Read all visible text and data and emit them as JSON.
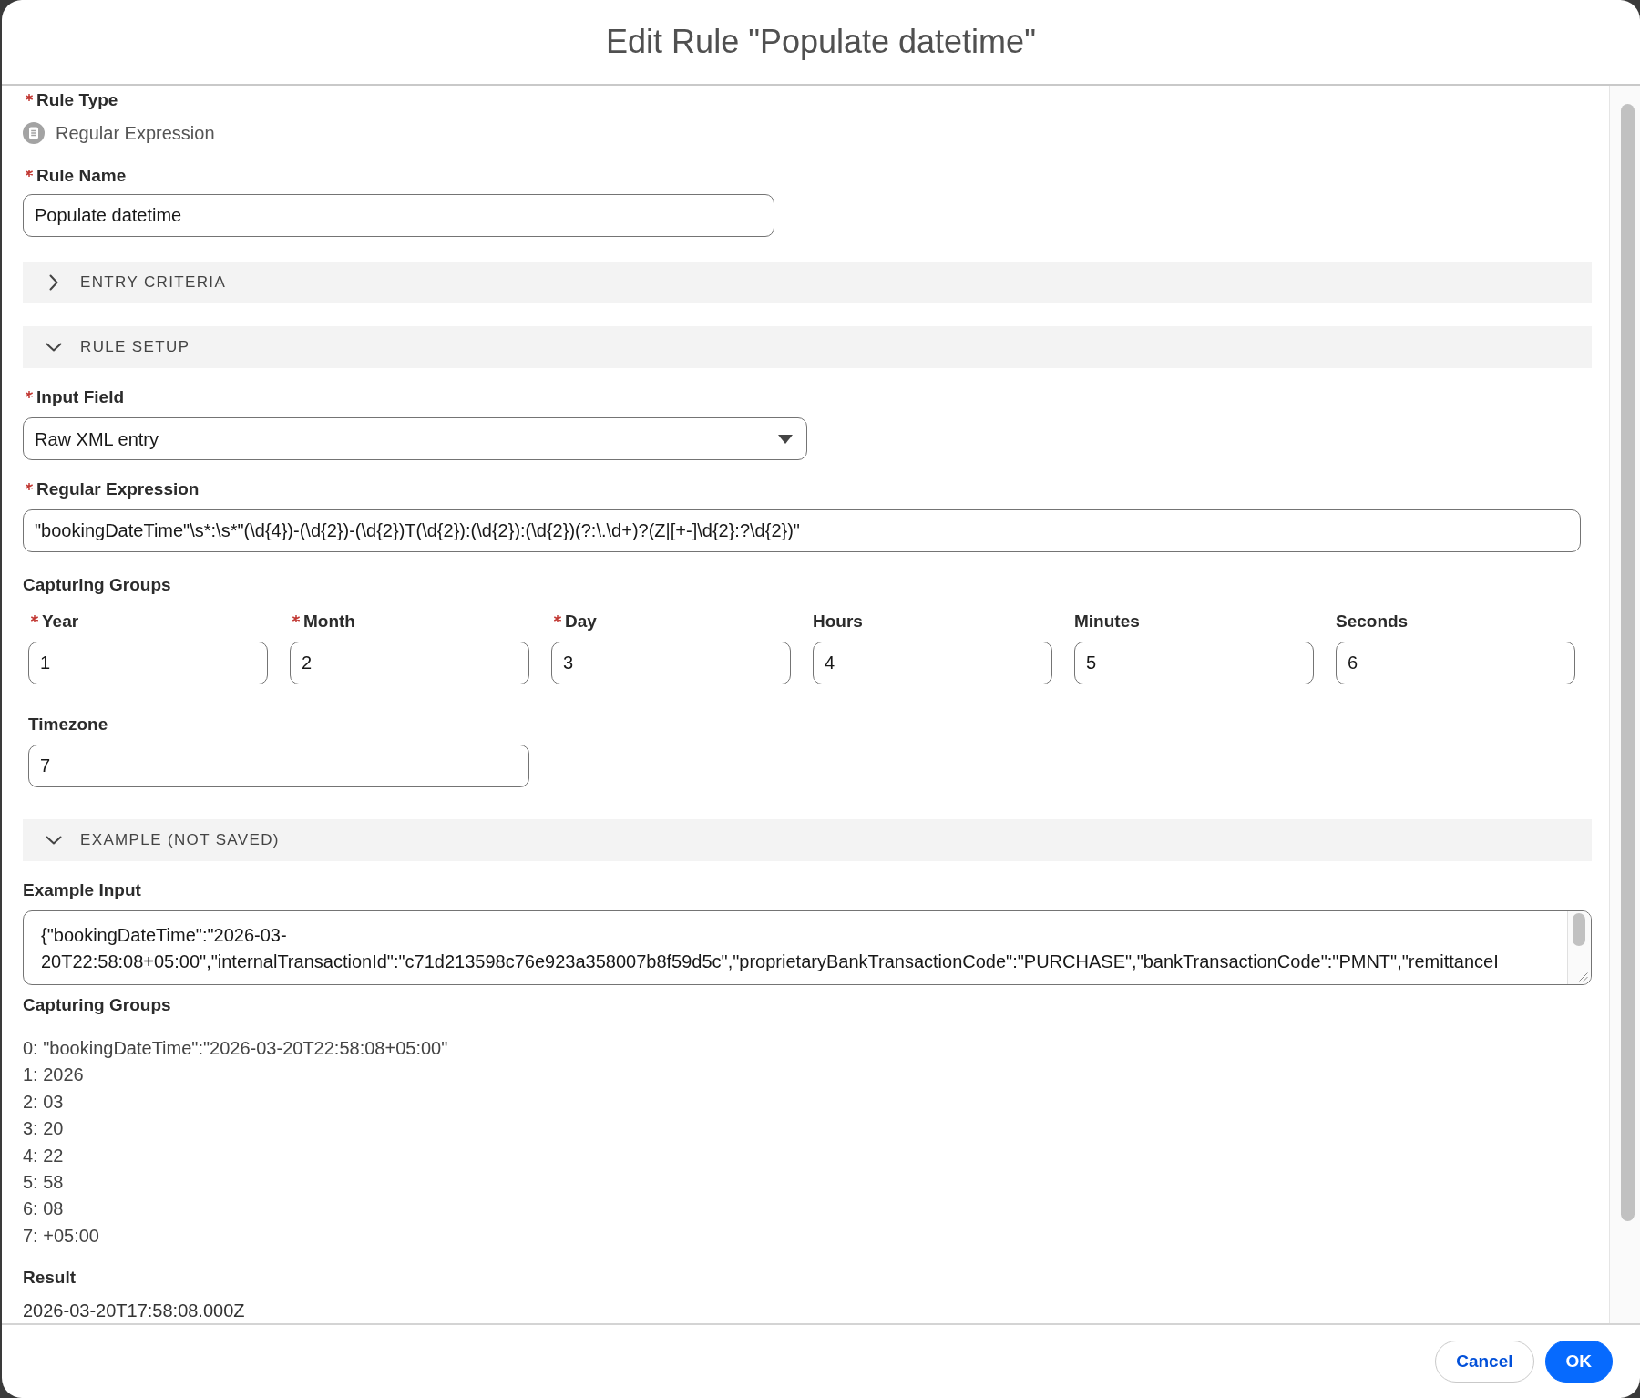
{
  "dialog": {
    "title": "Edit Rule \"Populate datetime\""
  },
  "rule_type": {
    "label": "Rule Type",
    "required": true,
    "value": "Regular Expression"
  },
  "rule_name": {
    "label": "Rule Name",
    "required": true,
    "value": "Populate datetime"
  },
  "sections": [
    {
      "title": "ENTRY CRITERIA",
      "expanded": false
    },
    {
      "title": "RULE SETUP",
      "expanded": true,
      "content": [
        {
          "kind": "dropdown",
          "label": "Input Field",
          "required": true,
          "value": "Raw XML entry"
        },
        {
          "kind": "text_field",
          "label": "Regular Expression",
          "required": true,
          "value": "\"bookingDateTime\"\\s*:\\s*\"(\\d{4})-(\\d{2})-(\\d{2})T(\\d{2}):(\\d{2}):(\\d{2})(?:\\.\\d+)?(Z|[+-]\\d{2}:?\\d{2})\""
        },
        {
          "kind": "group_fields",
          "label": "Capturing Groups",
          "fields": [
            {
              "label": "Year",
              "required": true,
              "value": "1"
            },
            {
              "label": "Month",
              "required": true,
              "value": "2"
            },
            {
              "label": "Day",
              "required": true,
              "value": "3"
            },
            {
              "label": "Hours",
              "required": false,
              "value": "4"
            },
            {
              "label": "Minutes",
              "required": false,
              "value": "5"
            },
            {
              "label": "Seconds",
              "required": false,
              "value": "6"
            }
          ],
          "timezone": {
            "label": "Timezone",
            "required": false,
            "value": "7"
          }
        }
      ]
    },
    {
      "title": "EXAMPLE (NOT SAVED)",
      "expanded": true,
      "content": [
        {
          "kind": "text_area",
          "label": "Example Input",
          "required": false,
          "lines": [
            "{\"bookingDateTime\":\"2026-03-",
            "20T22:58:08+05:00\",\"internalTransactionId\":\"c71d213598c76e923a358007b8f59d5c\",\"proprietaryBankTransactionCode\":\"PURCHASE\",\"bankTransactionCode\":\"PMNT\",\"remittanceI"
          ]
        },
        {
          "kind": "text_list",
          "label": "Capturing Groups",
          "lines": [
            "0: \"bookingDateTime\":\"2026-03-20T22:58:08+05:00\"",
            "1: 2026",
            "2: 03",
            "3: 20",
            "4: 22",
            "5: 58",
            "6: 08",
            "7: +05:00"
          ]
        },
        {
          "kind": "text_value",
          "label": "Result",
          "value": "2026-03-20T17:58:08.000Z"
        }
      ]
    }
  ],
  "buttons": [
    {
      "label": "Cancel",
      "kind": "neutral"
    },
    {
      "label": "OK",
      "kind": "brand"
    }
  ]
}
